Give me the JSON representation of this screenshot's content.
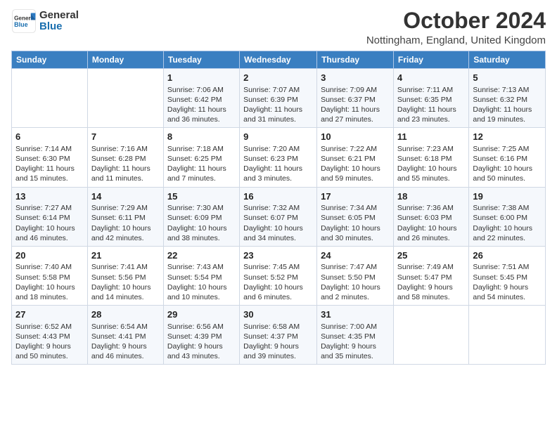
{
  "header": {
    "logo_text_general": "General",
    "logo_text_blue": "Blue",
    "month_title": "October 2024",
    "subtitle": "Nottingham, England, United Kingdom"
  },
  "calendar": {
    "days_of_week": [
      "Sunday",
      "Monday",
      "Tuesday",
      "Wednesday",
      "Thursday",
      "Friday",
      "Saturday"
    ],
    "weeks": [
      [
        {
          "day": "",
          "detail": ""
        },
        {
          "day": "",
          "detail": ""
        },
        {
          "day": "1",
          "detail": "Sunrise: 7:06 AM\nSunset: 6:42 PM\nDaylight: 11 hours and 36 minutes."
        },
        {
          "day": "2",
          "detail": "Sunrise: 7:07 AM\nSunset: 6:39 PM\nDaylight: 11 hours and 31 minutes."
        },
        {
          "day": "3",
          "detail": "Sunrise: 7:09 AM\nSunset: 6:37 PM\nDaylight: 11 hours and 27 minutes."
        },
        {
          "day": "4",
          "detail": "Sunrise: 7:11 AM\nSunset: 6:35 PM\nDaylight: 11 hours and 23 minutes."
        },
        {
          "day": "5",
          "detail": "Sunrise: 7:13 AM\nSunset: 6:32 PM\nDaylight: 11 hours and 19 minutes."
        }
      ],
      [
        {
          "day": "6",
          "detail": "Sunrise: 7:14 AM\nSunset: 6:30 PM\nDaylight: 11 hours and 15 minutes."
        },
        {
          "day": "7",
          "detail": "Sunrise: 7:16 AM\nSunset: 6:28 PM\nDaylight: 11 hours and 11 minutes."
        },
        {
          "day": "8",
          "detail": "Sunrise: 7:18 AM\nSunset: 6:25 PM\nDaylight: 11 hours and 7 minutes."
        },
        {
          "day": "9",
          "detail": "Sunrise: 7:20 AM\nSunset: 6:23 PM\nDaylight: 11 hours and 3 minutes."
        },
        {
          "day": "10",
          "detail": "Sunrise: 7:22 AM\nSunset: 6:21 PM\nDaylight: 10 hours and 59 minutes."
        },
        {
          "day": "11",
          "detail": "Sunrise: 7:23 AM\nSunset: 6:18 PM\nDaylight: 10 hours and 55 minutes."
        },
        {
          "day": "12",
          "detail": "Sunrise: 7:25 AM\nSunset: 6:16 PM\nDaylight: 10 hours and 50 minutes."
        }
      ],
      [
        {
          "day": "13",
          "detail": "Sunrise: 7:27 AM\nSunset: 6:14 PM\nDaylight: 10 hours and 46 minutes."
        },
        {
          "day": "14",
          "detail": "Sunrise: 7:29 AM\nSunset: 6:11 PM\nDaylight: 10 hours and 42 minutes."
        },
        {
          "day": "15",
          "detail": "Sunrise: 7:30 AM\nSunset: 6:09 PM\nDaylight: 10 hours and 38 minutes."
        },
        {
          "day": "16",
          "detail": "Sunrise: 7:32 AM\nSunset: 6:07 PM\nDaylight: 10 hours and 34 minutes."
        },
        {
          "day": "17",
          "detail": "Sunrise: 7:34 AM\nSunset: 6:05 PM\nDaylight: 10 hours and 30 minutes."
        },
        {
          "day": "18",
          "detail": "Sunrise: 7:36 AM\nSunset: 6:03 PM\nDaylight: 10 hours and 26 minutes."
        },
        {
          "day": "19",
          "detail": "Sunrise: 7:38 AM\nSunset: 6:00 PM\nDaylight: 10 hours and 22 minutes."
        }
      ],
      [
        {
          "day": "20",
          "detail": "Sunrise: 7:40 AM\nSunset: 5:58 PM\nDaylight: 10 hours and 18 minutes."
        },
        {
          "day": "21",
          "detail": "Sunrise: 7:41 AM\nSunset: 5:56 PM\nDaylight: 10 hours and 14 minutes."
        },
        {
          "day": "22",
          "detail": "Sunrise: 7:43 AM\nSunset: 5:54 PM\nDaylight: 10 hours and 10 minutes."
        },
        {
          "day": "23",
          "detail": "Sunrise: 7:45 AM\nSunset: 5:52 PM\nDaylight: 10 hours and 6 minutes."
        },
        {
          "day": "24",
          "detail": "Sunrise: 7:47 AM\nSunset: 5:50 PM\nDaylight: 10 hours and 2 minutes."
        },
        {
          "day": "25",
          "detail": "Sunrise: 7:49 AM\nSunset: 5:47 PM\nDaylight: 9 hours and 58 minutes."
        },
        {
          "day": "26",
          "detail": "Sunrise: 7:51 AM\nSunset: 5:45 PM\nDaylight: 9 hours and 54 minutes."
        }
      ],
      [
        {
          "day": "27",
          "detail": "Sunrise: 6:52 AM\nSunset: 4:43 PM\nDaylight: 9 hours and 50 minutes."
        },
        {
          "day": "28",
          "detail": "Sunrise: 6:54 AM\nSunset: 4:41 PM\nDaylight: 9 hours and 46 minutes."
        },
        {
          "day": "29",
          "detail": "Sunrise: 6:56 AM\nSunset: 4:39 PM\nDaylight: 9 hours and 43 minutes."
        },
        {
          "day": "30",
          "detail": "Sunrise: 6:58 AM\nSunset: 4:37 PM\nDaylight: 9 hours and 39 minutes."
        },
        {
          "day": "31",
          "detail": "Sunrise: 7:00 AM\nSunset: 4:35 PM\nDaylight: 9 hours and 35 minutes."
        },
        {
          "day": "",
          "detail": ""
        },
        {
          "day": "",
          "detail": ""
        }
      ]
    ]
  }
}
